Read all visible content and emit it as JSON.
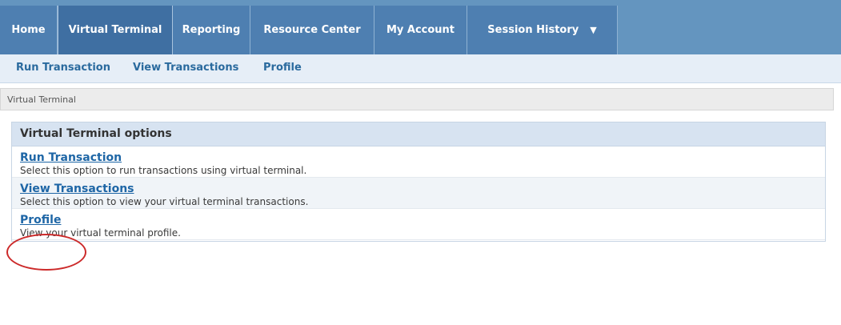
{
  "topnav": {
    "tabs": [
      {
        "label": "Home"
      },
      {
        "label": "Virtual Terminal"
      },
      {
        "label": "Reporting"
      },
      {
        "label": "Resource Center"
      },
      {
        "label": "My Account"
      },
      {
        "label": "Session History"
      }
    ],
    "active_tab": "Virtual Terminal"
  },
  "subnav": {
    "items": [
      {
        "label": "Run Transaction"
      },
      {
        "label": "View Transactions"
      },
      {
        "label": "Profile"
      }
    ]
  },
  "breadcrumb": "Virtual Terminal",
  "panel": {
    "title": "Virtual Terminal options",
    "options": [
      {
        "label": "Run Transaction",
        "description": "Select this option to run transactions using virtual terminal."
      },
      {
        "label": "View Transactions",
        "description": "Select this option to view your virtual terminal transactions."
      },
      {
        "label": "Profile",
        "description": "View your virtual terminal profile."
      }
    ]
  },
  "colors": {
    "nav_bar": "#6495bf",
    "tab": "#4e7fb1",
    "active_tab": "#3f6fa2",
    "link": "#1e66a6",
    "annotation": "#cc2a2a"
  },
  "icons": {
    "dropdown": "caret-down-icon"
  }
}
